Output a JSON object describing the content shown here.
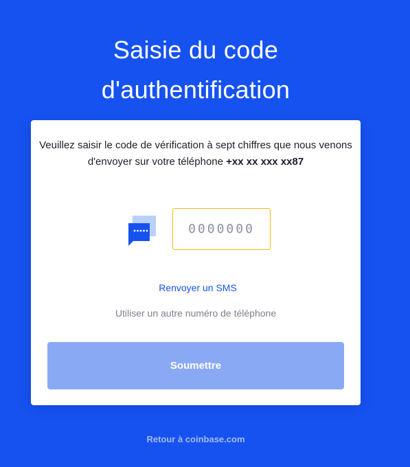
{
  "page": {
    "title_line1": "Saisie du code",
    "title_line2": "d'authentification"
  },
  "card": {
    "instructions": "Veuillez saisir le code de vérification à sept chiffres que nous venons d'envoyer sur votre téléphone",
    "phone_number": "+xx xx xxx xx87",
    "code_input": {
      "value": "",
      "placeholder": "0000000"
    },
    "resend_label": "Renvoyer un SMS",
    "other_number_label": "Utiliser un autre numéro de téléphone",
    "submit_label": "Soumettre"
  },
  "footer": {
    "back_link": "Retour à coinbase.com"
  },
  "colors": {
    "background": "#1652f0",
    "input_border": "#f0b90b",
    "submit_disabled": "#8aa9f5",
    "link": "#1652f0"
  },
  "icons": {
    "sms": "sms-chat-bubble-icon"
  }
}
